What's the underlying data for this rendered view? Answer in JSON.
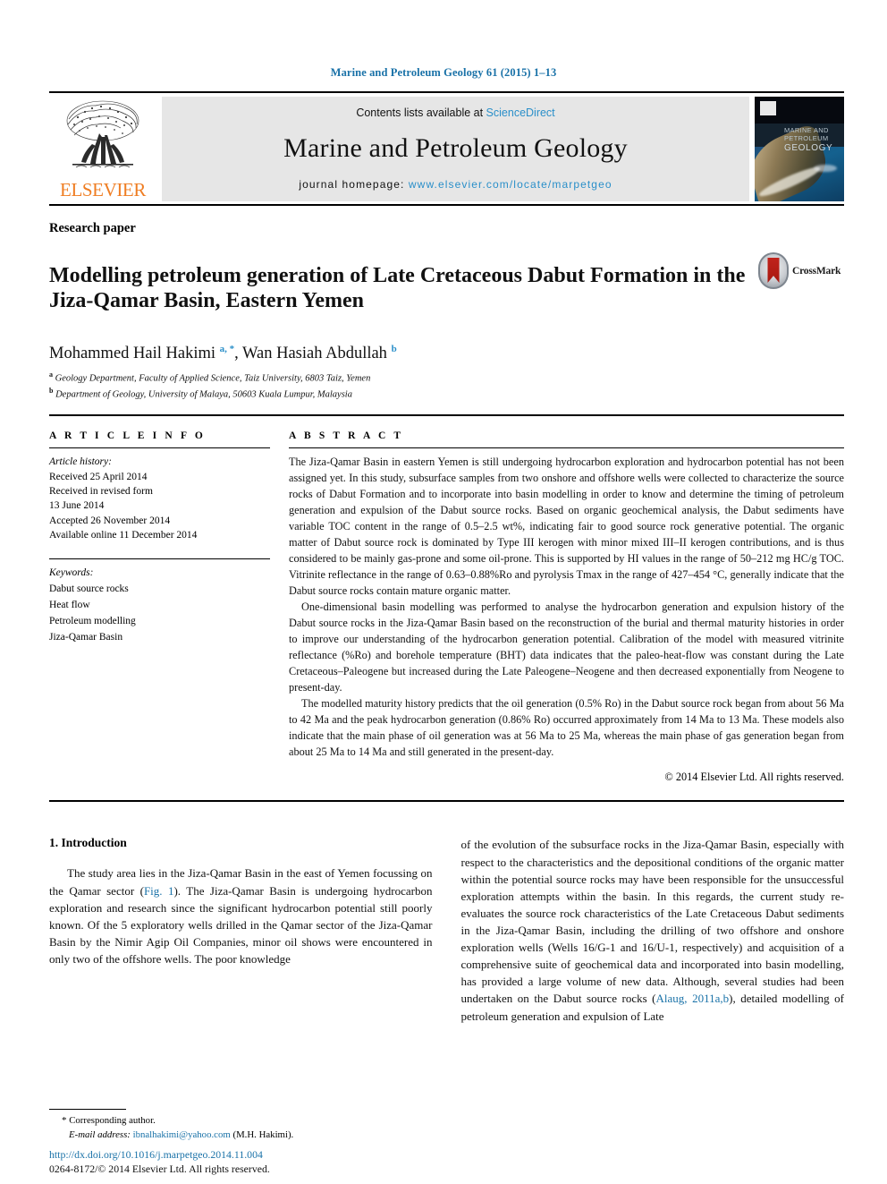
{
  "running_head": "Marine and Petroleum Geology 61 (2015) 1–13",
  "masthead": {
    "publisher_name": "ELSEVIER",
    "contents_prefix": "Contents lists available at ",
    "contents_link": "ScienceDirect",
    "journal_name": "Marine and Petroleum Geology",
    "homepage_prefix": "journal homepage: ",
    "homepage_url": "www.elsevier.com/locate/marpetgeo",
    "cover_title_line1": "MARINE AND",
    "cover_title_line2": "PETROLEUM",
    "cover_title_line3": "GEOLOGY"
  },
  "article": {
    "type": "Research paper",
    "title": "Modelling petroleum generation of Late Cretaceous Dabut Formation in the Jiza-Qamar Basin, Eastern Yemen",
    "crossmark_label": "CrossMark",
    "authors_html": "Mohammed Hail Hakimi <sup>a, *</sup>, Wan Hasiah Abdullah <sup>b</sup>",
    "affiliation_a": "Geology Department, Faculty of Applied Science, Taiz University, 6803 Taiz, Yemen",
    "affiliation_b": "Department of Geology, University of Malaya, 50603 Kuala Lumpur, Malaysia"
  },
  "article_info": {
    "heading": "A R T I C L E   I N F O",
    "history_label": "Article history:",
    "history": [
      "Received 25 April 2014",
      "Received in revised form",
      "13 June 2014",
      "Accepted 26 November 2014",
      "Available online 11 December 2014"
    ],
    "keywords_label": "Keywords:",
    "keywords": [
      "Dabut source rocks",
      "Heat flow",
      "Petroleum modelling",
      "Jiza-Qamar Basin"
    ]
  },
  "abstract": {
    "heading": "A B S T R A C T",
    "paragraphs": [
      "The Jiza-Qamar Basin in eastern Yemen is still undergoing hydrocarbon exploration and hydrocarbon potential has not been assigned yet. In this study, subsurface samples from two onshore and offshore wells were collected to characterize the source rocks of Dabut Formation and to incorporate into basin modelling in order to know and determine the timing of petroleum generation and expulsion of the Dabut source rocks. Based on organic geochemical analysis, the Dabut sediments have variable TOC content in the range of 0.5–2.5 wt%, indicating fair to good source rock generative potential. The organic matter of Dabut source rock is dominated by Type III kerogen with minor mixed III–II kerogen contributions, and is thus considered to be mainly gas-prone and some oil-prone. This is supported by HI values in the range of 50–212 mg HC/g TOC. Vitrinite reflectance in the range of 0.63–0.88%Ro and pyrolysis Tmax in the range of 427–454 °C, generally indicate that the Dabut source rocks contain mature organic matter.",
      "One-dimensional basin modelling was performed to analyse the hydrocarbon generation and expulsion history of the Dabut source rocks in the Jiza-Qamar Basin based on the reconstruction of the burial and thermal maturity histories in order to improve our understanding of the hydrocarbon generation potential. Calibration of the model with measured vitrinite reflectance (%Ro) and borehole temperature (BHT) data indicates that the paleo-heat-flow was constant during the Late Cretaceous–Paleogene but increased during the Late Paleogene–Neogene and then decreased exponentially from Neogene to present-day.",
      "The modelled maturity history predicts that the oil generation (0.5% Ro) in the Dabut source rock began from about 56 Ma to 42 Ma and the peak hydrocarbon generation (0.86% Ro) occurred approximately from 14 Ma to 13 Ma. These models also indicate that the main phase of oil generation was at 56 Ma to 25 Ma, whereas the main phase of gas generation began from about 25 Ma to 14 Ma and still generated in the present-day."
    ],
    "copyright": "© 2014 Elsevier Ltd. All rights reserved."
  },
  "introduction": {
    "number_title": "1.  Introduction",
    "left_paragraph_pre": "The study area lies in the Jiza-Qamar Basin in the east of Yemen focussing on the Qamar sector (",
    "left_link": "Fig. 1",
    "left_paragraph_post": "). The Jiza-Qamar Basin is undergoing hydrocarbon exploration and research since the significant hydrocarbon potential still poorly known. Of the 5 exploratory wells drilled in the Qamar sector of the Jiza-Qamar Basin by the Nimir Agip Oil Companies, minor oil shows were encountered in only two of the offshore wells. The poor knowledge",
    "right_paragraph_pre": "of the evolution of the subsurface rocks in the Jiza-Qamar Basin, especially with respect to the characteristics and the depositional conditions of the organic matter within the potential source rocks may have been responsible for the unsuccessful exploration attempts within the basin. In this regards, the current study re-evaluates the source rock characteristics of the Late Cretaceous Dabut sediments in the Jiza-Qamar Basin, including the drilling of two offshore and onshore exploration wells (Wells 16/G-1 and 16/U-1, respectively) and acquisition of a comprehensive suite of geochemical data and incorporated into basin modelling, has provided a large volume of new data. Although, several studies had been undertaken on the Dabut source rocks (",
    "right_link": "Alaug, 2011a,b",
    "right_paragraph_post": "), detailed modelling of petroleum generation and expulsion of Late"
  },
  "footer": {
    "corresponding_star": "*",
    "corresponding_label": "Corresponding author.",
    "email_label": "E-mail address:",
    "email": "ibnalhakimi@yahoo.com",
    "email_owner": "(M.H. Hakimi).",
    "doi": "http://dx.doi.org/10.1016/j.marpetgeo.2014.11.004",
    "issn_line": "0264-8172/© 2014 Elsevier Ltd. All rights reserved."
  }
}
